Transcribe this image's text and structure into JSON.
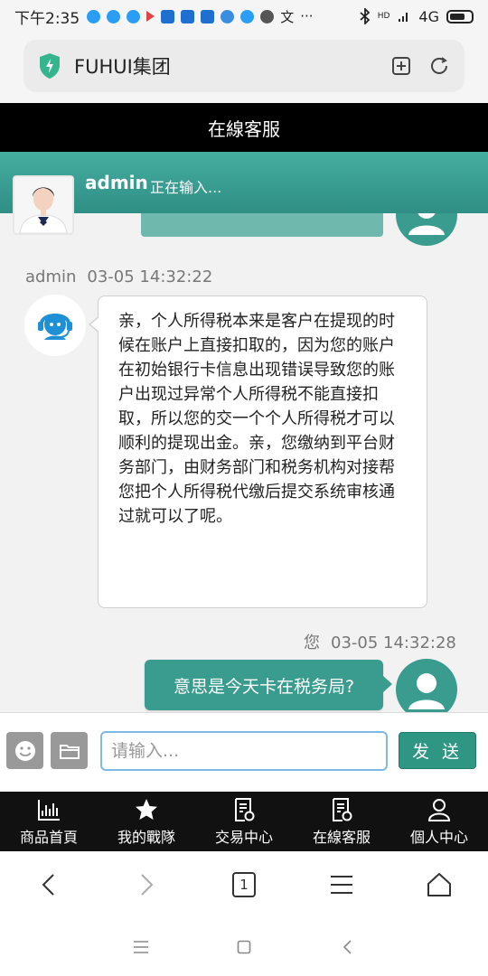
{
  "status_bar": {
    "time": "下午2:35",
    "network": "4G",
    "hd_label": "HD",
    "text_icon": "文",
    "dots": "···"
  },
  "browser": {
    "title": "FUHUI集团",
    "icons": [
      "shield-icon",
      "add-tab-icon",
      "refresh-icon"
    ]
  },
  "page": {
    "title": "在線客服"
  },
  "agent": {
    "name": "admin",
    "status": "正在输入..."
  },
  "messages": [
    {
      "sender": "admin",
      "time": "03-05 14:32:22",
      "side": "left",
      "text": "亲，个人所得税本来是客户在提现的时候在账户上直接扣取的，因为您的账户在初始银行卡信息出现错误导致您的账户出现过异常个人所得税不能直接扣取，所以您的交一个个人所得税才可以顺利的提现出金。亲，您缴纳到平台财务部门，由财务部门和税务机构对接帮您把个人所得税代缴后提交系统审核通过就可以了呢。"
    },
    {
      "sender": "您",
      "time": "03-05 14:32:28",
      "side": "right",
      "text": "意思是今天卡在税务局?"
    }
  ],
  "input": {
    "placeholder": "请输入...",
    "value": "",
    "send_label": "发 送",
    "emoji_icon": "smiley-icon",
    "file_icon": "folder-icon"
  },
  "tabs": [
    {
      "label": "商品首頁",
      "icon": "chart-icon"
    },
    {
      "label": "我的戰隊",
      "icon": "star-icon"
    },
    {
      "label": "交易中心",
      "icon": "document-icon"
    },
    {
      "label": "在線客服",
      "icon": "document-icon"
    },
    {
      "label": "個人中心",
      "icon": "user-icon"
    }
  ],
  "browser_nav": {
    "tab_count": "1"
  },
  "colors": {
    "accent": "#3a9c8f",
    "header_bg": "#000000",
    "send_button": "#2f9683"
  }
}
